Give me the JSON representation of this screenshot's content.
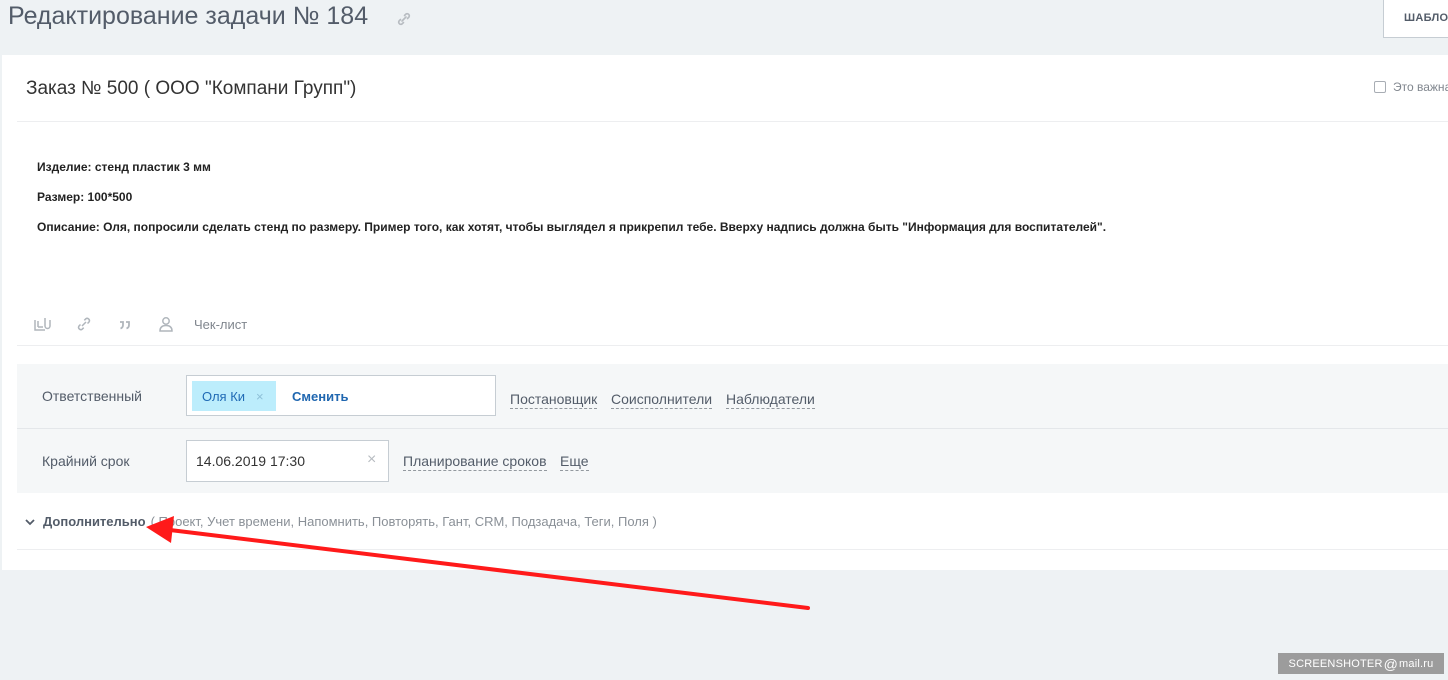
{
  "header": {
    "title": "Редактирование задачи № 184",
    "templates_label": "ШАБЛОНЫ"
  },
  "task": {
    "name": "Заказ № 500 ( ООО \"Компани Групп\")",
    "important_label": "Это важная задача",
    "description": [
      "Изделие: стенд пластик 3 мм",
      "Размер: 100*500",
      "Описание: Оля, попросили сделать стенд по размеру. Пример того, как хотят, чтобы выглядел я прикрепил тебе. Вверху надпись должна быть \"Информация для воспитателей\"."
    ]
  },
  "toolbar": {
    "checklist_label": "Чек-лист",
    "icons": [
      "file-upload-icon",
      "link-icon",
      "quote-icon",
      "user-mention-icon"
    ]
  },
  "responsible": {
    "label": "Ответственный",
    "user": "Оля Ки",
    "remove_glyph": "×",
    "change_label": "Сменить",
    "links": [
      "Постановщик",
      "Соисполнители",
      "Наблюдатели"
    ]
  },
  "deadline": {
    "label": "Крайний срок",
    "value": "14.06.2019 17:30",
    "clear_glyph": "×",
    "planning_label": "Планирование сроков",
    "more_label": "Еще"
  },
  "additional": {
    "label": "Дополнительно",
    "items": "( Проект,  Учет времени,  Напомнить,  Повторять,  Гант,  CRM,  Подзадача,  Теги,  Поля )"
  },
  "watermark": {
    "prefix": "SCREENSHOTER",
    "at": "@",
    "suffix": "mail.ru"
  },
  "colors": {
    "background": "#eef2f4",
    "chip": "#bcedfc",
    "link": "#2067b0",
    "annotation_arrow": "#ff1a1a"
  }
}
